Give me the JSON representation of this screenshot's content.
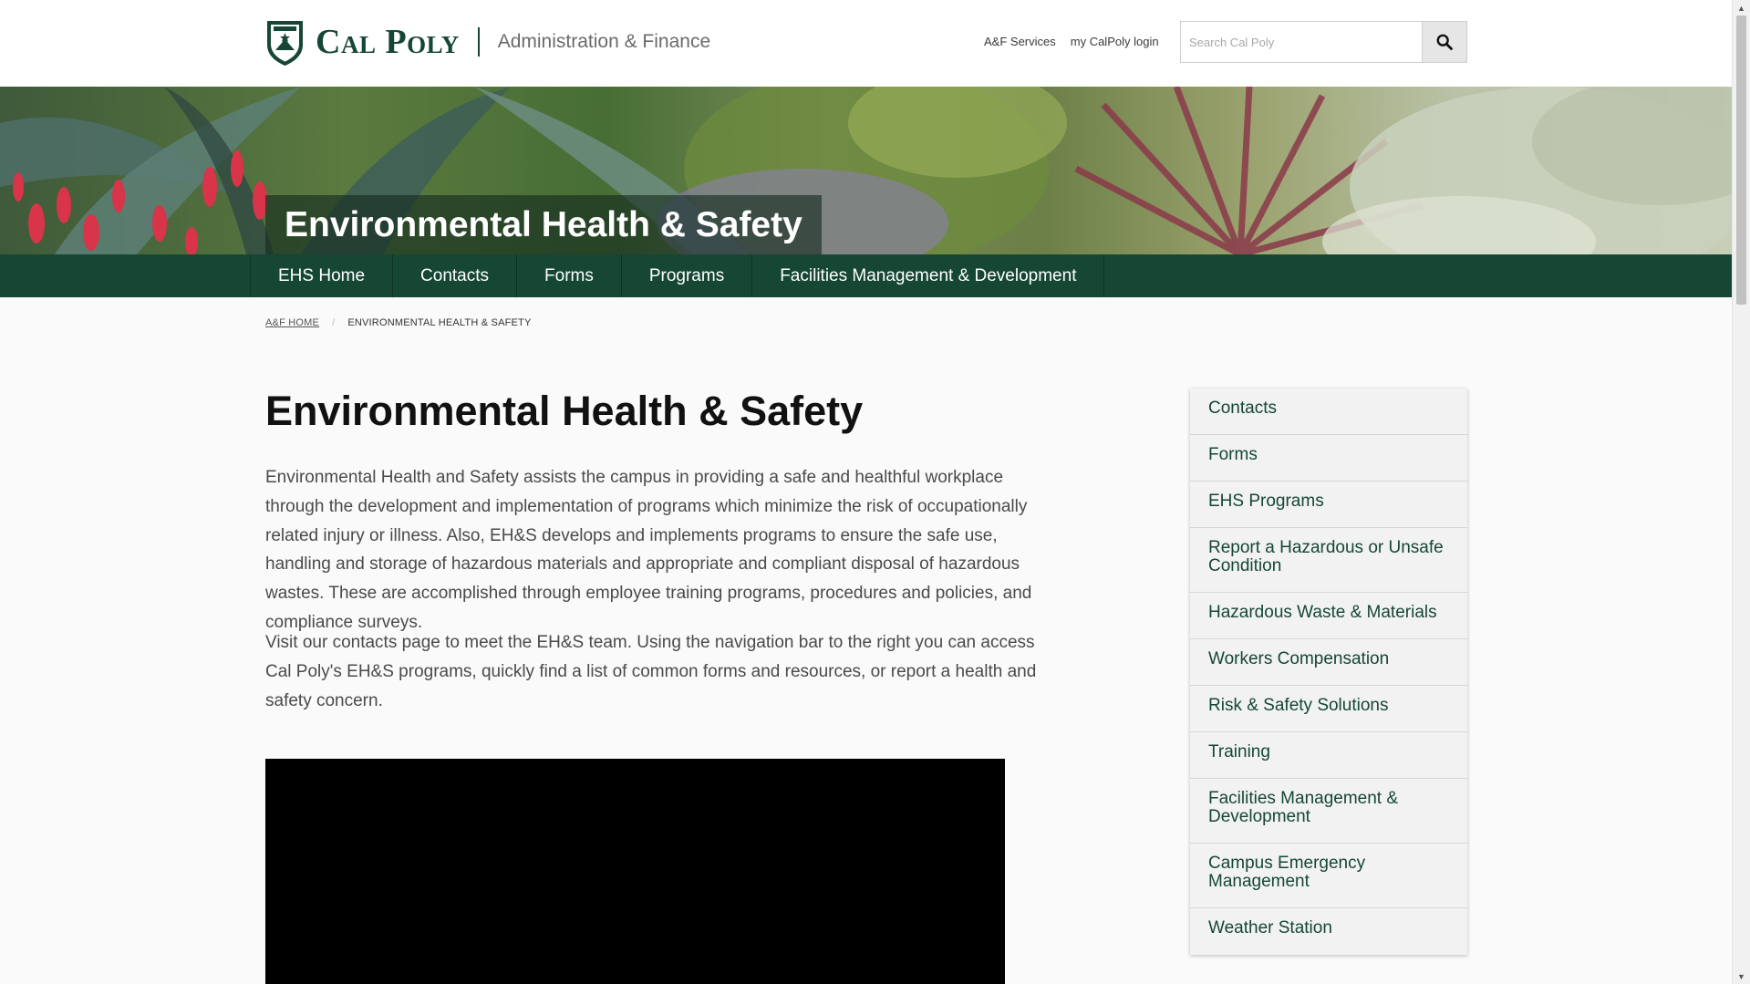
{
  "header": {
    "wordmark": "Cal Poly",
    "unit_name": "Administration & Finance",
    "utility_links": [
      "A&F Services",
      "my CalPoly login"
    ],
    "search": {
      "placeholder": "Search Cal Poly",
      "value": "",
      "icon": "search-icon"
    }
  },
  "banner": {
    "title": "Environmental Health & Safety"
  },
  "main_nav": {
    "items": [
      "EHS Home",
      "Contacts",
      "Forms",
      "Programs",
      "Facilities Management & Development"
    ]
  },
  "breadcrumb": {
    "home": "A&F HOME",
    "current": "ENVIRONMENTAL HEALTH & SAFETY"
  },
  "main": {
    "title": "Environmental Health & Safety",
    "paragraphs": [
      "Environmental Health and Safety assists the campus in providing a safe and healthful workplace through the development and implementation of programs which minimize the risk of occupationally related injury or illness. Also, EH&S develops and implements programs to ensure the safe use, handling and storage of hazardous materials and appropriate and compliant disposal of hazardous wastes. These are accomplished through employee training programs, procedures and policies, and compliance surveys.",
      "Visit our contacts page to meet the EH&S team. Using the navigation bar to the right you can access Cal Poly's EH&S programs, quickly find a list of common forms and resources, or report a health and safety concern."
    ]
  },
  "sidebar": {
    "items": [
      "Contacts",
      "Forms",
      "EHS Programs",
      "Report a Hazardous or Unsafe Condition",
      "Hazardous Waste & Materials",
      "Workers Compensation",
      "Risk & Safety Solutions",
      "Training",
      "Facilities Management & Development",
      "Campus Emergency Management",
      "Weather Station"
    ]
  },
  "colors": {
    "brand_green": "#154734",
    "sidebar_bg": "#f2f2f2",
    "page_bg": "#fafafa"
  }
}
